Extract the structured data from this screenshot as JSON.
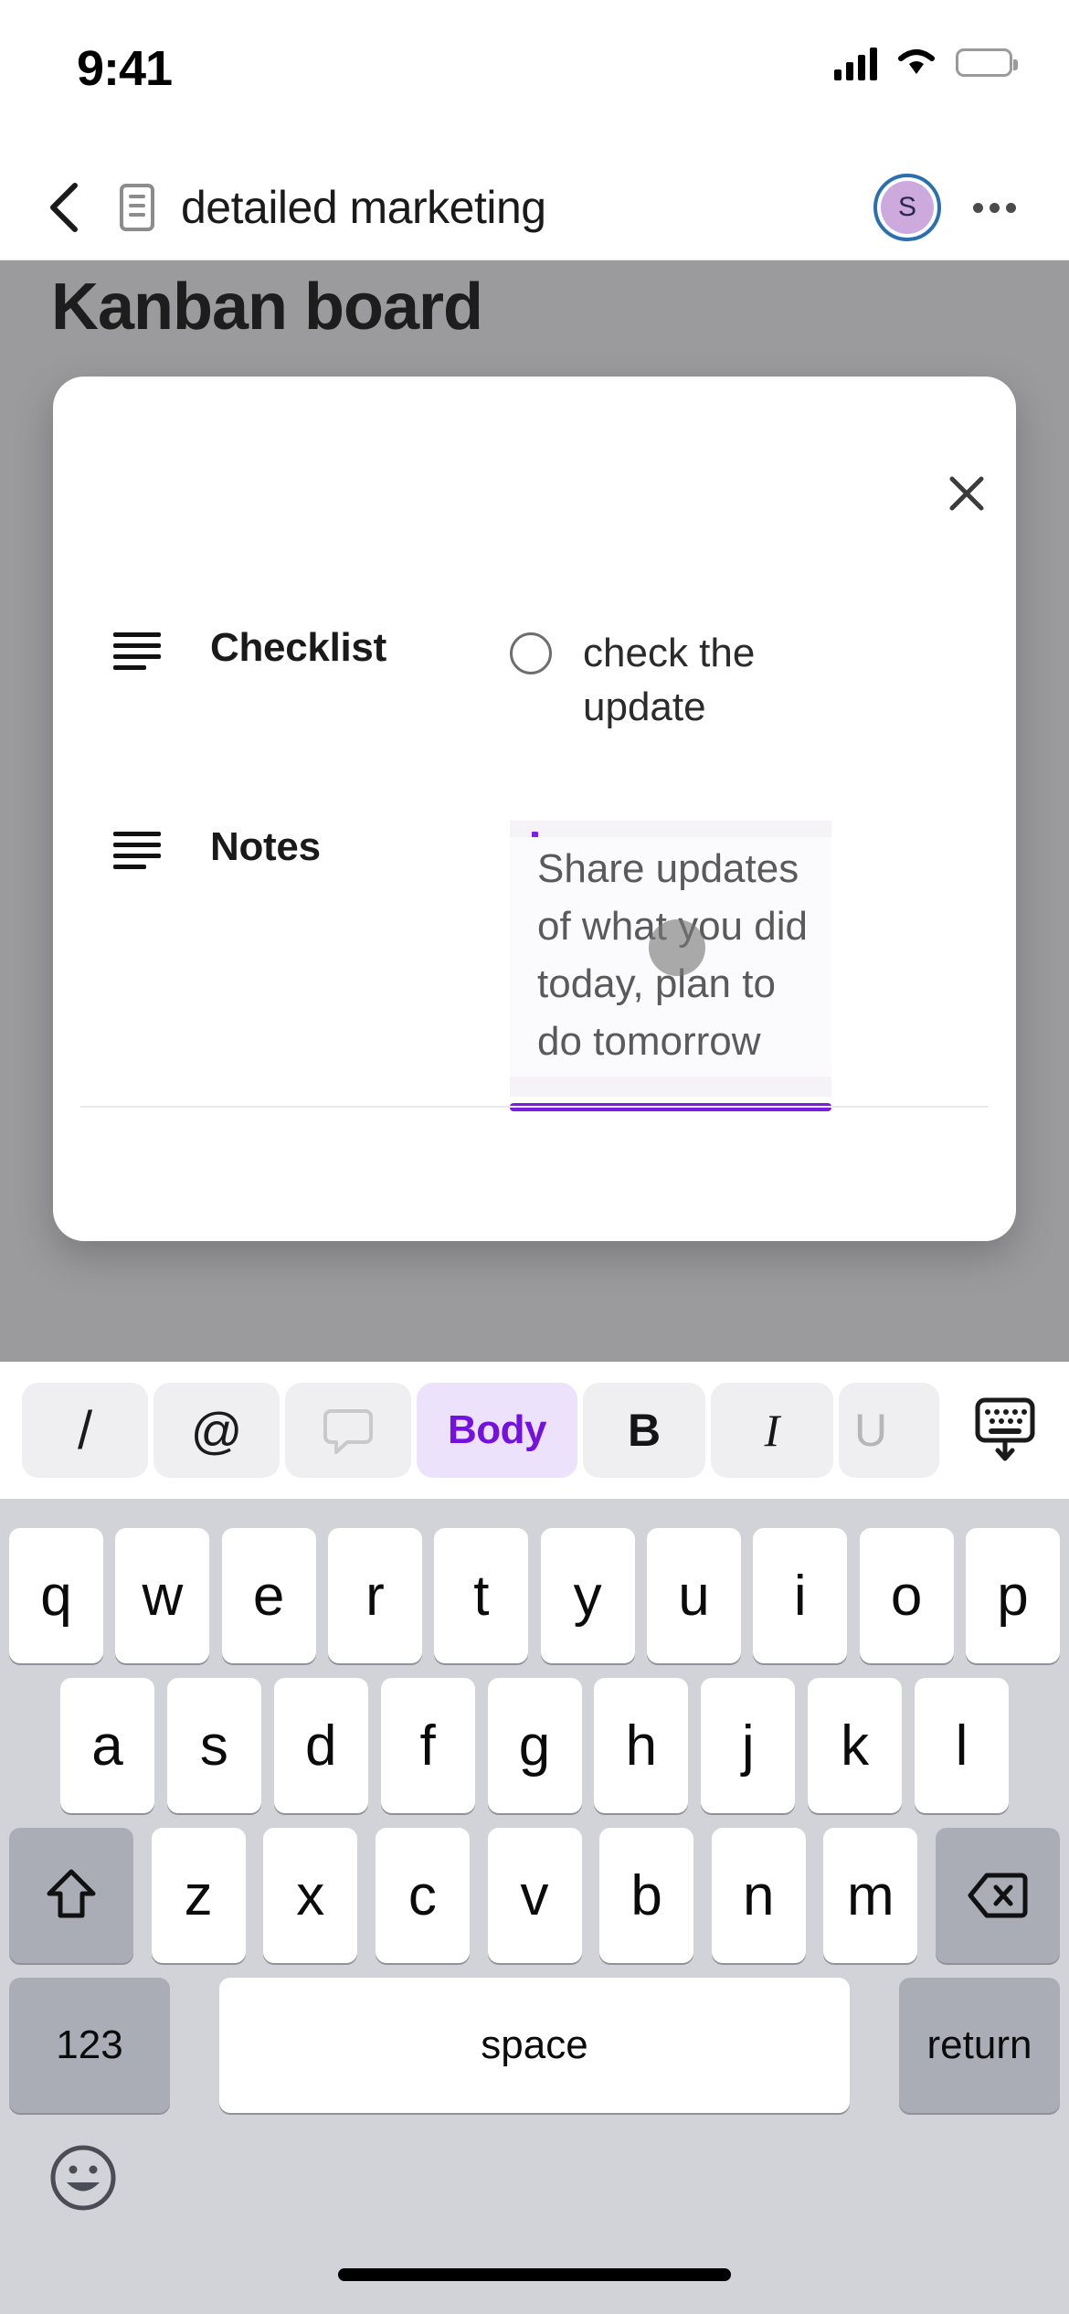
{
  "status_bar": {
    "time": "9:41",
    "signal_icon": "cellular-signal-icon",
    "wifi_icon": "wifi-icon",
    "battery_icon": "battery-icon"
  },
  "nav_bar": {
    "back_icon": "chevron-left-icon",
    "document_icon": "document-icon",
    "title": "detailed marketing",
    "avatar_initial": "S",
    "avatar_bg": "#cdaade",
    "avatar_ring": "#2a6fb0",
    "more_icon": "more-options-icon"
  },
  "board": {
    "title": "Kanban board",
    "overlay_color": "#9b9b9e"
  },
  "modal": {
    "close_icon": "close-icon",
    "fields": [
      {
        "icon": "list-lines-icon",
        "label": "Checklist",
        "checkbox_state": "unchecked",
        "item_text": "check the update"
      },
      {
        "icon": "list-lines-icon",
        "label": "Notes",
        "placeholder": "Share updates of what you did today, plan to do tomorrow",
        "caret_color": "#7d21e8",
        "underline_color": "#7b1ce0",
        "field_bg": "#f5f3f7"
      }
    ]
  },
  "format_toolbar": {
    "items": [
      {
        "name": "slash-command-button",
        "label": "/",
        "state": "default"
      },
      {
        "name": "mention-button",
        "label": "@",
        "state": "default"
      },
      {
        "name": "comment-button",
        "label": "comment-icon",
        "state": "disabled"
      },
      {
        "name": "text-style-button",
        "label": "Body",
        "state": "active",
        "color": "#7411e0"
      },
      {
        "name": "bold-button",
        "label": "B",
        "state": "default"
      },
      {
        "name": "italic-button",
        "label": "I",
        "state": "default"
      },
      {
        "name": "underline-button",
        "label": "U",
        "state": "clipped"
      },
      {
        "name": "dismiss-keyboard-button",
        "label": "keyboard-dismiss-icon",
        "state": "default"
      }
    ]
  },
  "keyboard": {
    "row1": [
      "q",
      "w",
      "e",
      "r",
      "t",
      "y",
      "u",
      "i",
      "o",
      "p"
    ],
    "row2": [
      "a",
      "s",
      "d",
      "f",
      "g",
      "h",
      "j",
      "k",
      "l"
    ],
    "row3": [
      "z",
      "x",
      "c",
      "v",
      "b",
      "n",
      "m"
    ],
    "shift_icon": "shift-icon",
    "backspace_icon": "backspace-icon",
    "numbers_key": "123",
    "space_key": "space",
    "return_key": "return",
    "emoji_icon": "emoji-icon"
  }
}
